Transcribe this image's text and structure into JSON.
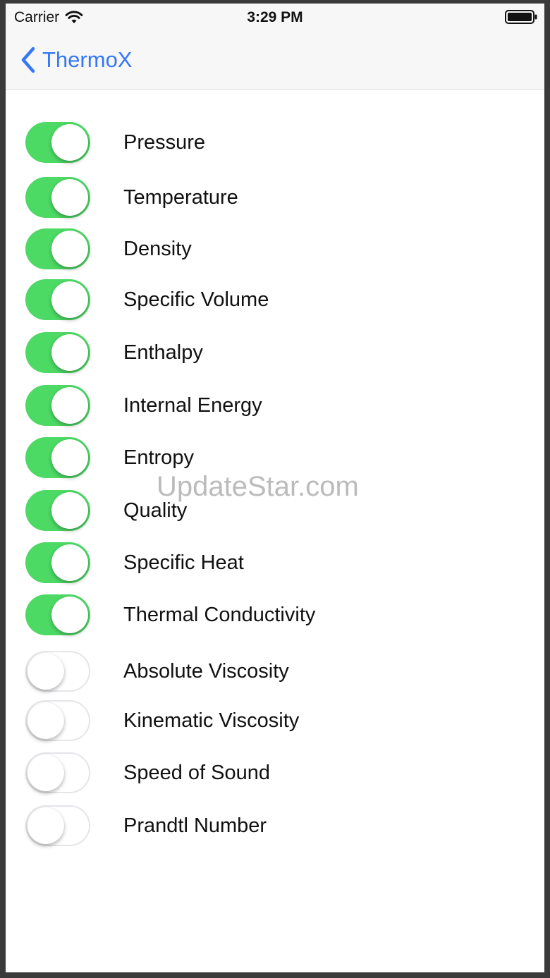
{
  "status_bar": {
    "carrier": "Carrier",
    "time": "3:29 PM",
    "wifi_icon": "wifi-icon",
    "battery_icon": "battery-icon"
  },
  "nav": {
    "back_label": "ThermoX",
    "back_icon": "chevron-left-icon",
    "accent_color": "#3478f6"
  },
  "toggle_colors": {
    "on": "#4cd964",
    "off_border": "#e5e5ea"
  },
  "properties": [
    {
      "label": "Pressure",
      "enabled": true
    },
    {
      "label": "Temperature",
      "enabled": true
    },
    {
      "label": "Density",
      "enabled": true
    },
    {
      "label": "Specific Volume",
      "enabled": true
    },
    {
      "label": "Enthalpy",
      "enabled": true
    },
    {
      "label": "Internal Energy",
      "enabled": true
    },
    {
      "label": "Entropy",
      "enabled": true
    },
    {
      "label": "Quality",
      "enabled": true
    },
    {
      "label": "Specific Heat",
      "enabled": true
    },
    {
      "label": "Thermal Conductivity",
      "enabled": true
    },
    {
      "label": "Absolute Viscosity",
      "enabled": false
    },
    {
      "label": "Kinematic Viscosity",
      "enabled": false
    },
    {
      "label": "Speed of Sound",
      "enabled": false
    },
    {
      "label": "Prandtl Number",
      "enabled": false
    }
  ],
  "watermark": "UpdateStar.com"
}
